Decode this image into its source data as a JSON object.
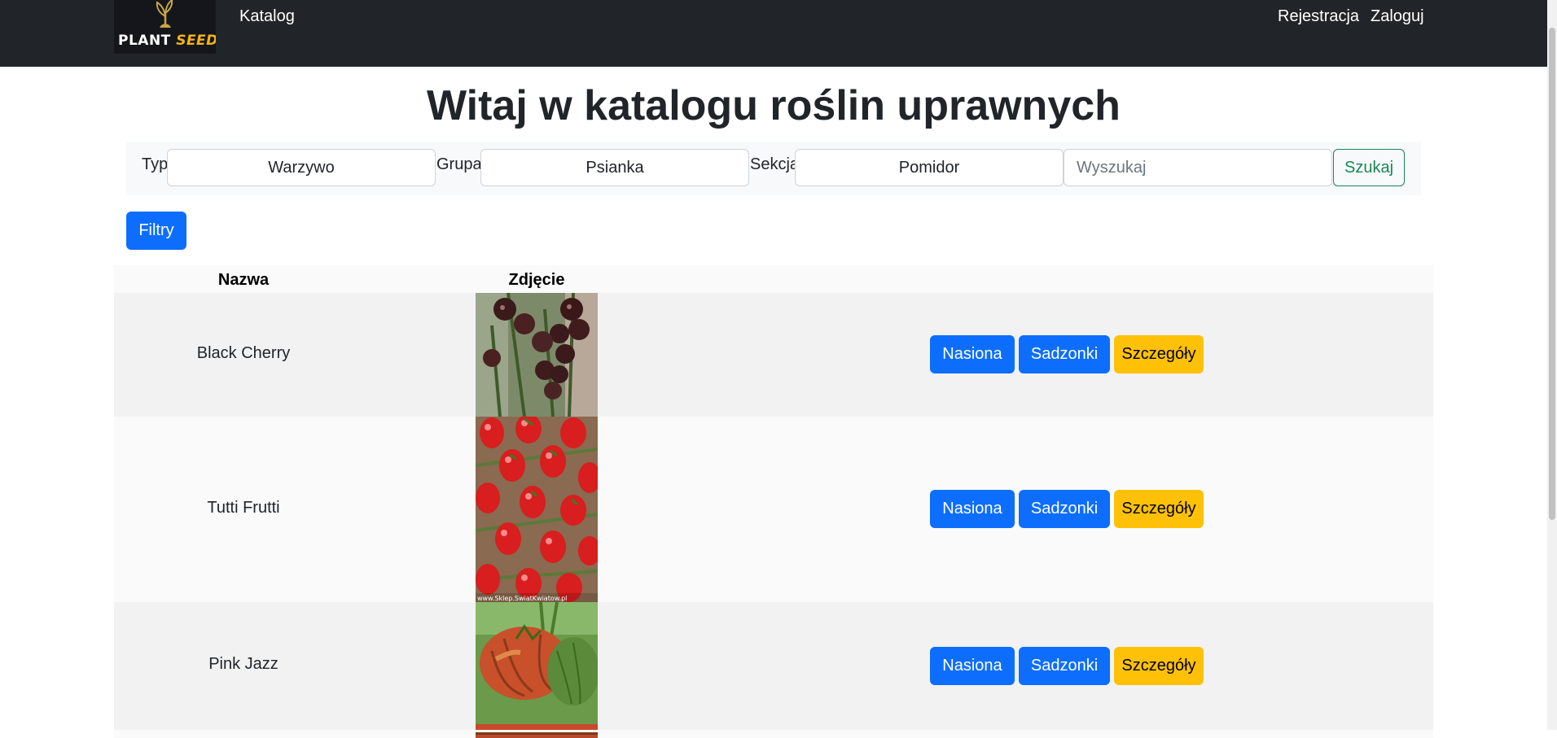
{
  "navbar": {
    "logo_word1": "PLANT",
    "logo_word2": "SEEDER",
    "katalog": "Katalog",
    "register": "Rejestracja",
    "login": "Zaloguj"
  },
  "title": "Witaj w katalogu roślin uprawnych",
  "filters": {
    "type_label": "Typ",
    "type_value": "Warzywo",
    "group_label": "Grupa",
    "group_value": "Psianka",
    "section_label": "Sekcja",
    "section_value": "Pomidor",
    "search_placeholder": "Wyszukaj",
    "search_button": "Szukaj"
  },
  "filters_button": "Filtry",
  "table": {
    "headers": [
      "Nazwa",
      "Zdjęcie"
    ],
    "rows": [
      {
        "name": "Black Cherry"
      },
      {
        "name": "Tutti Frutti",
        "watermark": "www.Sklep.SwiatKwiatow.pl"
      },
      {
        "name": "Pink Jazz"
      }
    ],
    "buttons": {
      "seeds": "Nasiona",
      "seedlings": "Sadzonki",
      "details": "Szczegóły"
    }
  },
  "colors": {
    "navbar": "#212529",
    "primary": "#0d6efd",
    "warning": "#ffc107",
    "success": "#198754"
  }
}
